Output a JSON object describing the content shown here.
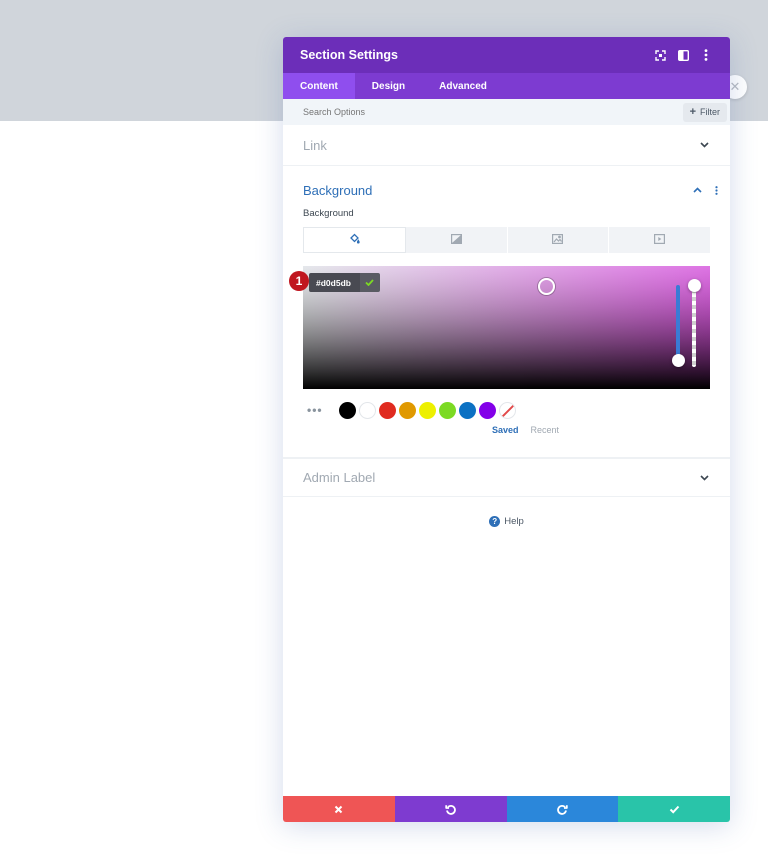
{
  "modal": {
    "title": "Section Settings",
    "header_icons": [
      "expand-icon",
      "split-view-icon",
      "more-vertical-icon"
    ]
  },
  "tabs": [
    {
      "label": "Content",
      "active": true
    },
    {
      "label": "Design",
      "active": false
    },
    {
      "label": "Advanced",
      "active": false
    }
  ],
  "search": {
    "placeholder": "Search Options",
    "filter_label": "Filter"
  },
  "groups": {
    "link": {
      "title": "Link"
    },
    "background": {
      "title": "Background",
      "field_label": "Background",
      "bg_types": [
        "paint-bucket-icon",
        "gradient-icon",
        "image-icon",
        "video-icon"
      ],
      "selected_type": 0
    },
    "admin_label": {
      "title": "Admin Label"
    }
  },
  "color_picker": {
    "hex_value": "#d0d5db",
    "marker_number": "1",
    "swatches": [
      "#000000",
      "#ffffff",
      "#e02b20",
      "#e09900",
      "#edf000",
      "#7cda24",
      "#0c71c3",
      "#8300e9"
    ],
    "swatch_tabs": [
      {
        "label": "Saved",
        "active": true
      },
      {
        "label": "Recent",
        "active": false
      }
    ]
  },
  "help": {
    "label": "Help"
  },
  "footer": {
    "buttons": [
      "cancel",
      "undo",
      "redo",
      "save"
    ],
    "colors": {
      "cancel": "#ef5555",
      "undo": "#7e3bd0",
      "redo": "#2b87da",
      "save": "#29c4a9"
    }
  },
  "colors": {
    "header": "#6c2eb9",
    "tabs": "#7d3bd1",
    "active_tab": "#8f4eee",
    "accent_blue": "#2e6fb7",
    "page_band": "#d0d5db"
  }
}
